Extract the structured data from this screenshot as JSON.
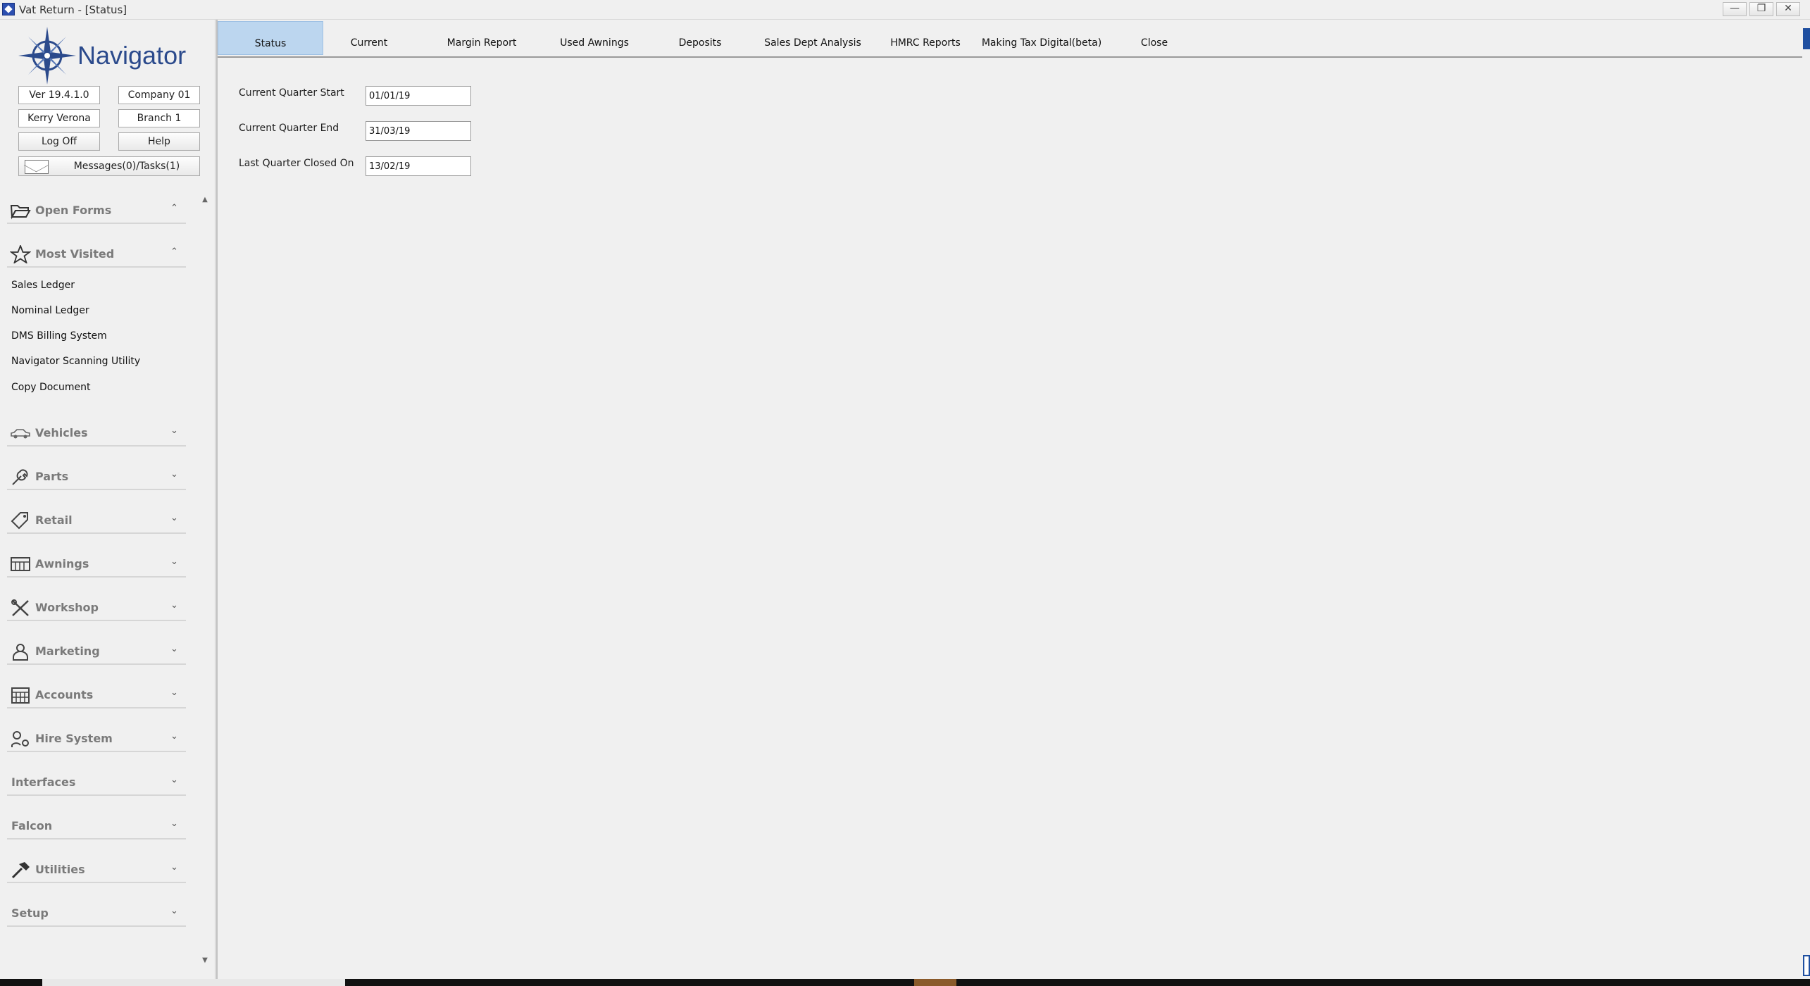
{
  "window": {
    "title": "Vat Return - [Status]",
    "controls": {
      "minimize": "—",
      "restore": "❐",
      "close": "✕"
    }
  },
  "sidebar": {
    "logo_text": "Navigator",
    "version": "Ver 19.4.1.0",
    "company": "Company 01",
    "user": "Kerry Verona",
    "branch": "Branch 1",
    "log_off": "Log Off",
    "help": "Help",
    "messages": "Messages(0)/Tasks(1)",
    "sections": {
      "open_forms": "Open Forms",
      "most_visited": "Most Visited",
      "vehicles": "Vehicles",
      "parts": "Parts",
      "retail": "Retail",
      "awnings": "Awnings",
      "workshop": "Workshop",
      "marketing": "Marketing",
      "accounts": "Accounts",
      "hire_system": "Hire System",
      "interfaces": "Interfaces",
      "falcon": "Falcon",
      "utilities": "Utilities",
      "setup": "Setup"
    },
    "most_visited_items": {
      "0": "Sales Ledger",
      "1": "Nominal Ledger",
      "2": "DMS Billing System",
      "3": "Navigator Scanning Utility",
      "4": "Copy Document"
    },
    "chev_up": "⌃",
    "chev_down": "⌄"
  },
  "tabs": {
    "status": "Status",
    "current": "Current",
    "margin_report": "Margin Report",
    "used_awnings": "Used Awnings",
    "deposits": "Deposits",
    "sales_dept_analysis": "Sales Dept Analysis",
    "hmrc_reports": "HMRC Reports",
    "making_tax_digital": "Making Tax Digital(beta)",
    "close": "Close"
  },
  "form": {
    "current_quarter_start_label": "Current Quarter Start",
    "current_quarter_start_value": "01/01/19",
    "current_quarter_end_label": "Current Quarter End",
    "current_quarter_end_value": "31/03/19",
    "last_quarter_closed_label": "Last Quarter Closed On",
    "last_quarter_closed_value": "13/02/19"
  },
  "colors": {
    "active_tab": "#bcd6ef",
    "logo_blue": "#2b4a8c"
  }
}
